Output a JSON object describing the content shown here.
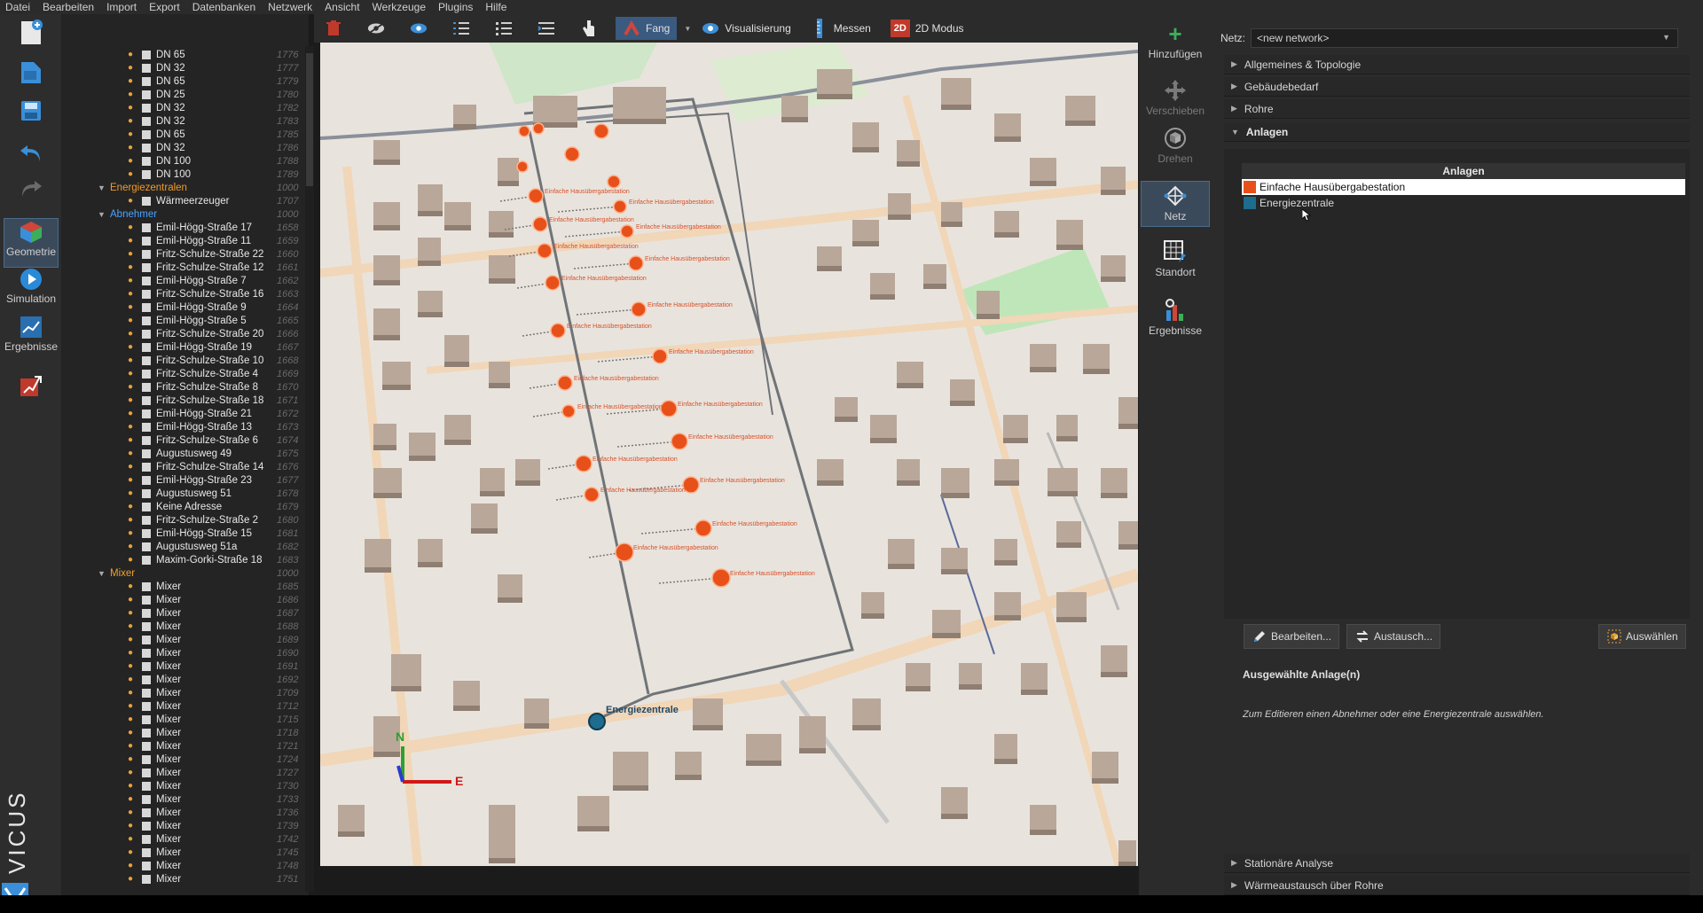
{
  "menu": [
    "Datei",
    "Bearbeiten",
    "Import",
    "Export",
    "Datenbanken",
    "Netzwerk",
    "Ansicht",
    "Werkzeuge",
    "Plugins",
    "Hilfe"
  ],
  "leftbar": {
    "geometrie": "Geometrie",
    "simulation": "Simulation",
    "ergebnisse": "Ergebnisse"
  },
  "brand": "VICUS",
  "toolbar": {
    "fang": "Fang",
    "visualisierung": "Visualisierung",
    "messen": "Messen",
    "modus": "2D Modus",
    "modus_badge": "2D"
  },
  "tree": {
    "top_rows": [
      {
        "label": "DN 65",
        "num": "1776"
      },
      {
        "label": "DN 32",
        "num": "1777"
      },
      {
        "label": "DN 65",
        "num": "1779"
      },
      {
        "label": "DN 25",
        "num": "1780"
      },
      {
        "label": "DN 32",
        "num": "1782"
      },
      {
        "label": "DN 32",
        "num": "1783"
      },
      {
        "label": "DN 65",
        "num": "1785"
      },
      {
        "label": "DN 32",
        "num": "1786"
      },
      {
        "label": "DN 100",
        "num": "1788"
      },
      {
        "label": "DN 100",
        "num": "1789"
      }
    ],
    "energiezentralen": {
      "label": "Energiezentralen",
      "num": "1000"
    },
    "energiezentralen_rows": [
      {
        "label": "Wärmeerzeuger",
        "num": "1707"
      }
    ],
    "abnehmer": {
      "label": "Abnehmer",
      "num": "1000"
    },
    "abnehmer_rows": [
      {
        "label": "Emil-Högg-Straße 17",
        "num": "1658"
      },
      {
        "label": "Emil-Högg-Straße 11",
        "num": "1659"
      },
      {
        "label": "Fritz-Schulze-Straße 22",
        "num": "1660"
      },
      {
        "label": "Fritz-Schulze-Straße 12",
        "num": "1661"
      },
      {
        "label": "Emil-Högg-Straße 7",
        "num": "1662"
      },
      {
        "label": "Fritz-Schulze-Straße 16",
        "num": "1663"
      },
      {
        "label": "Emil-Högg-Straße 9",
        "num": "1664"
      },
      {
        "label": "Emil-Högg-Straße 5",
        "num": "1665"
      },
      {
        "label": "Fritz-Schulze-Straße 20",
        "num": "1666"
      },
      {
        "label": "Emil-Högg-Straße 19",
        "num": "1667"
      },
      {
        "label": "Fritz-Schulze-Straße 10",
        "num": "1668"
      },
      {
        "label": "Fritz-Schulze-Straße 4",
        "num": "1669"
      },
      {
        "label": "Fritz-Schulze-Straße 8",
        "num": "1670"
      },
      {
        "label": "Fritz-Schulze-Straße 18",
        "num": "1671"
      },
      {
        "label": "Emil-Högg-Straße 21",
        "num": "1672"
      },
      {
        "label": "Emil-Högg-Straße 13",
        "num": "1673"
      },
      {
        "label": "Fritz-Schulze-Straße 6",
        "num": "1674"
      },
      {
        "label": "Augustusweg 49",
        "num": "1675"
      },
      {
        "label": "Fritz-Schulze-Straße 14",
        "num": "1676"
      },
      {
        "label": "Emil-Högg-Straße 23",
        "num": "1677"
      },
      {
        "label": "Augustusweg 51",
        "num": "1678"
      },
      {
        "label": "Keine Adresse",
        "num": "1679"
      },
      {
        "label": "Fritz-Schulze-Straße 2",
        "num": "1680"
      },
      {
        "label": "Emil-Högg-Straße 15",
        "num": "1681"
      },
      {
        "label": "Augustusweg 51a",
        "num": "1682"
      },
      {
        "label": "Maxim-Gorki-Straße 18",
        "num": "1683"
      }
    ],
    "mixer": {
      "label": "Mixer",
      "num": "1000"
    },
    "mixer_rows": [
      {
        "label": "Mixer",
        "num": "1685"
      },
      {
        "label": "Mixer",
        "num": "1686"
      },
      {
        "label": "Mixer",
        "num": "1687"
      },
      {
        "label": "Mixer",
        "num": "1688"
      },
      {
        "label": "Mixer",
        "num": "1689"
      },
      {
        "label": "Mixer",
        "num": "1690"
      },
      {
        "label": "Mixer",
        "num": "1691"
      },
      {
        "label": "Mixer",
        "num": "1692"
      },
      {
        "label": "Mixer",
        "num": "1709"
      },
      {
        "label": "Mixer",
        "num": "1712"
      },
      {
        "label": "Mixer",
        "num": "1715"
      },
      {
        "label": "Mixer",
        "num": "1718"
      },
      {
        "label": "Mixer",
        "num": "1721"
      },
      {
        "label": "Mixer",
        "num": "1724"
      },
      {
        "label": "Mixer",
        "num": "1727"
      },
      {
        "label": "Mixer",
        "num": "1730"
      },
      {
        "label": "Mixer",
        "num": "1733"
      },
      {
        "label": "Mixer",
        "num": "1736"
      },
      {
        "label": "Mixer",
        "num": "1739"
      },
      {
        "label": "Mixer",
        "num": "1742"
      },
      {
        "label": "Mixer",
        "num": "1745"
      },
      {
        "label": "Mixer",
        "num": "1748"
      },
      {
        "label": "Mixer",
        "num": "1751"
      }
    ]
  },
  "viewport": {
    "substation_label": "Einfache Hausübergabestation",
    "central_label": "Energiezentrale",
    "axis_n": "N",
    "axis_e": "E"
  },
  "rightbar": {
    "hinzufuegen": "Hinzufügen",
    "verschieben": "Verschieben",
    "drehen": "Drehen",
    "netz": "Netz",
    "standort": "Standort",
    "ergebnisse": "Ergebnisse"
  },
  "props": {
    "netz_label": "Netz:",
    "netz_value": "<new network>",
    "sections": {
      "allgemeines": "Allgemeines & Topologie",
      "gebaeude": "Gebäudebedarf",
      "rohre": "Rohre",
      "anlagen": "Anlagen",
      "stationaer": "Stationäre Analyse",
      "waerme": "Wärmeaustausch über Rohre"
    },
    "table_header": "Anlagen",
    "rows": [
      {
        "label": "Einfache Hausübergabestation",
        "color": "#e8501a"
      },
      {
        "label": "Energiezentrale",
        "color": "#1e6c8e"
      }
    ],
    "btn_bearbeiten": "Bearbeiten...",
    "btn_austausch": "Austausch...",
    "btn_auswaehlen": "Auswählen",
    "selected_title": "Ausgewählte Anlage(n)",
    "selected_hint": "Zum Editieren einen Abnehmer oder eine Energiezentrale auswählen."
  },
  "colors": {
    "accent": "#3a5a80",
    "substation": "#e8501a",
    "central": "#1e6c8e"
  }
}
